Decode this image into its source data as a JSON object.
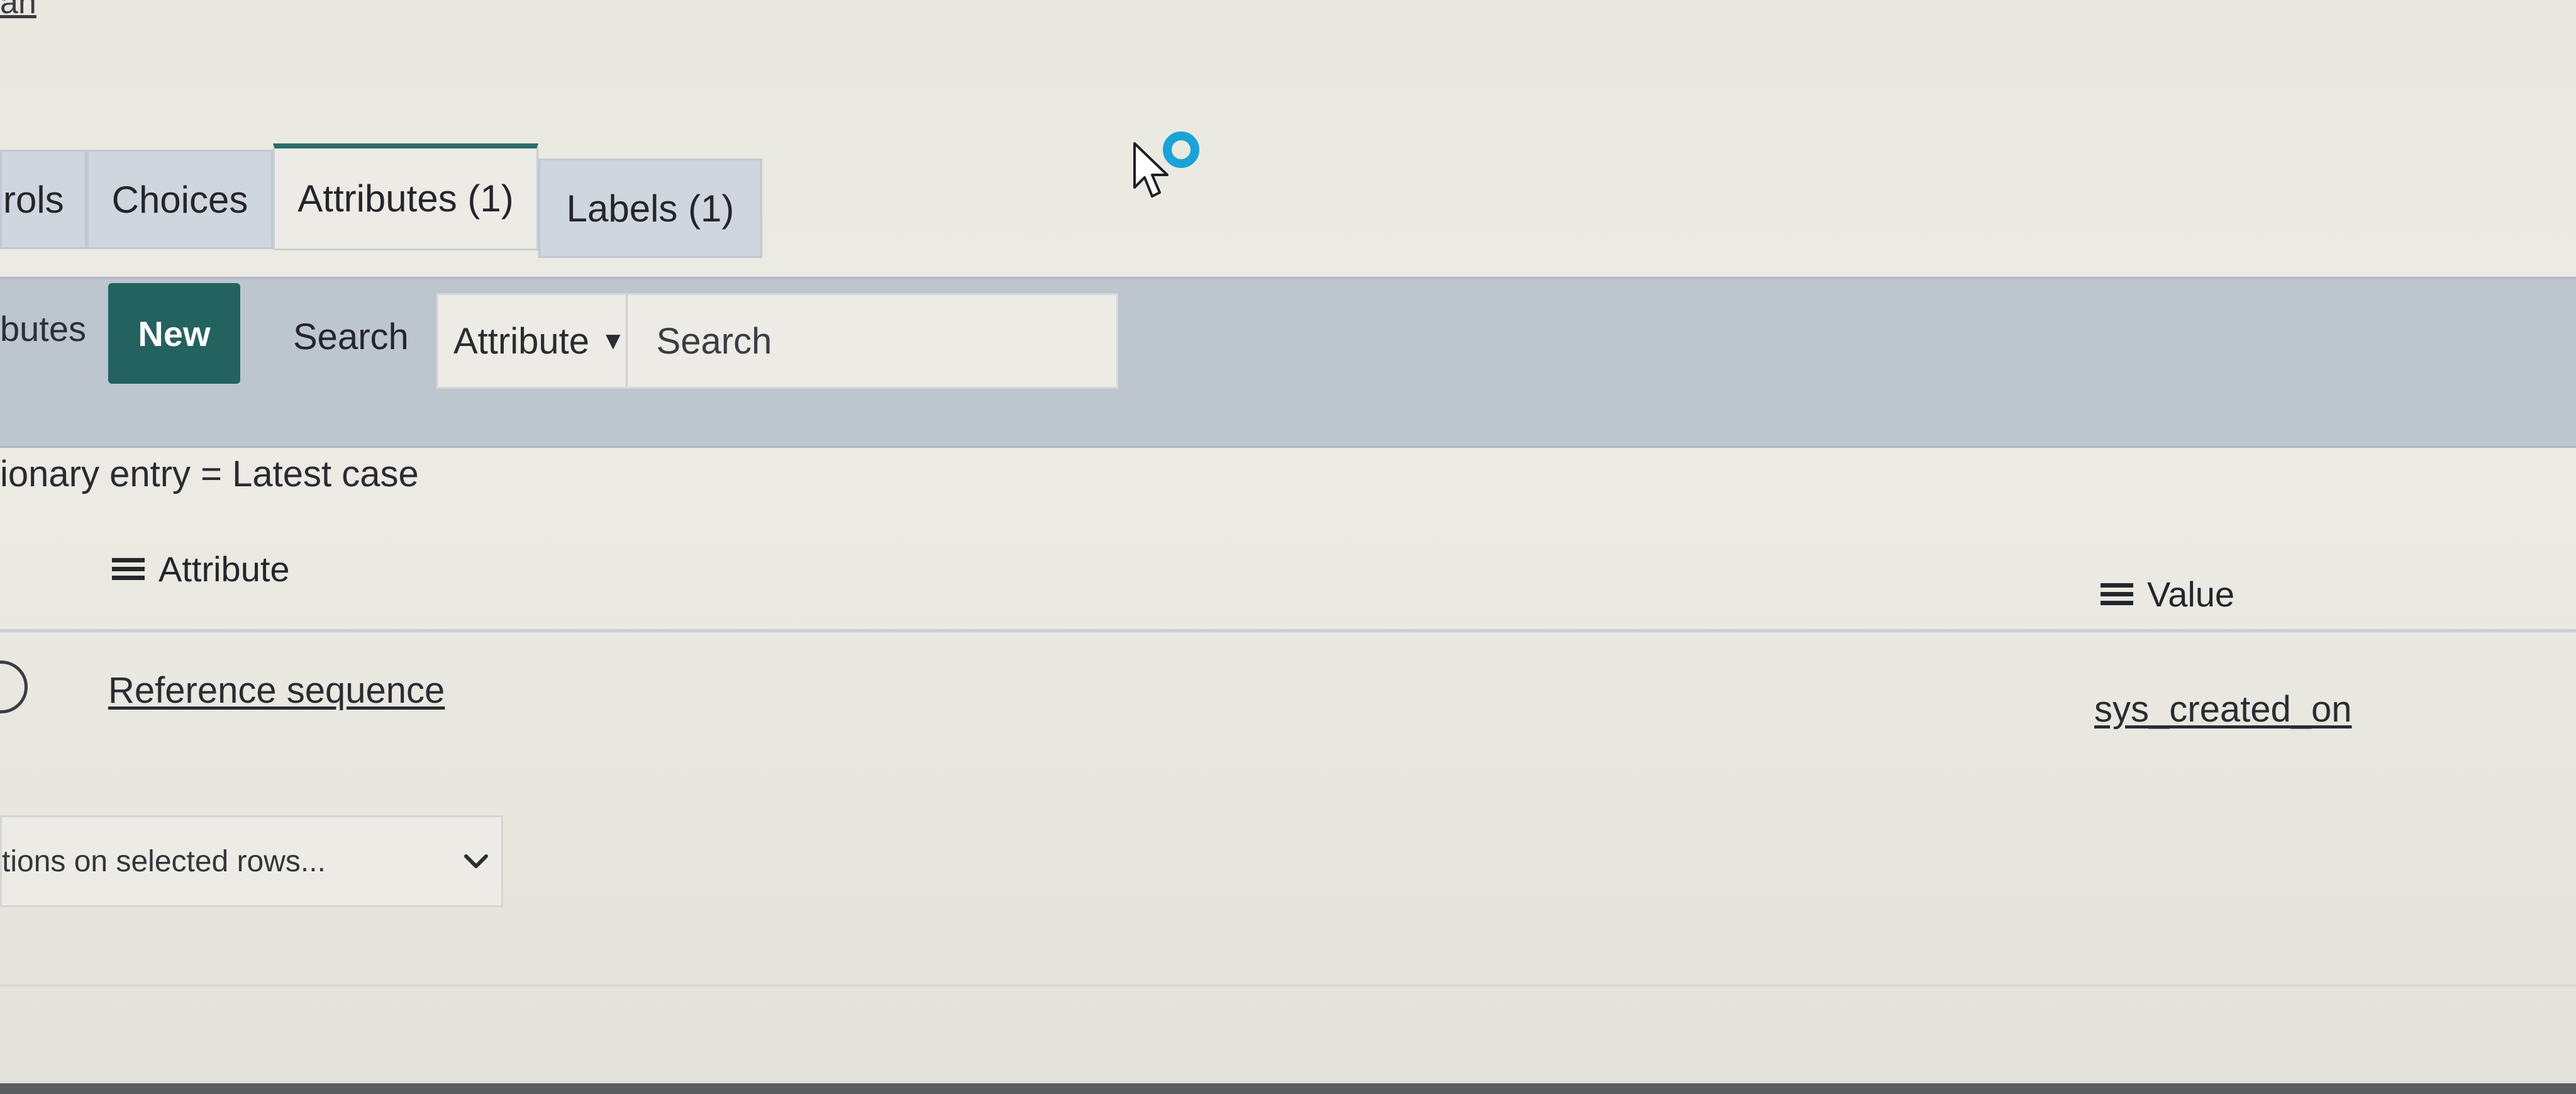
{
  "header": {
    "top_link": "an"
  },
  "tabs": [
    {
      "label": "rols"
    },
    {
      "label": "Choices"
    },
    {
      "label": "Attributes (1)"
    },
    {
      "label": "Labels (1)"
    }
  ],
  "toolbar": {
    "title": "butes",
    "new_label": "New",
    "search_label": "Search",
    "search_field": "Attribute",
    "search_placeholder": "Search"
  },
  "filter": {
    "text": "ionary entry = Latest case"
  },
  "table": {
    "columns": [
      {
        "label": "Attribute"
      },
      {
        "label": "Value"
      }
    ],
    "rows": [
      {
        "attribute": "Reference sequence",
        "value": "sys_created_on"
      }
    ]
  },
  "actions": {
    "label": "tions on selected rows..."
  },
  "colors": {
    "accent": "#23625f",
    "toolbar_bg": "#bdc5cf",
    "page_bg": "#e9e8e1",
    "loading_ring": "#1aa3d8"
  },
  "icons": {
    "cursor": "pointer-arrow-icon",
    "loading": "loading-ring-icon",
    "caret": "caret-down-icon",
    "hamburger": "hamburger-icon",
    "chevron": "chevron-down-icon"
  }
}
